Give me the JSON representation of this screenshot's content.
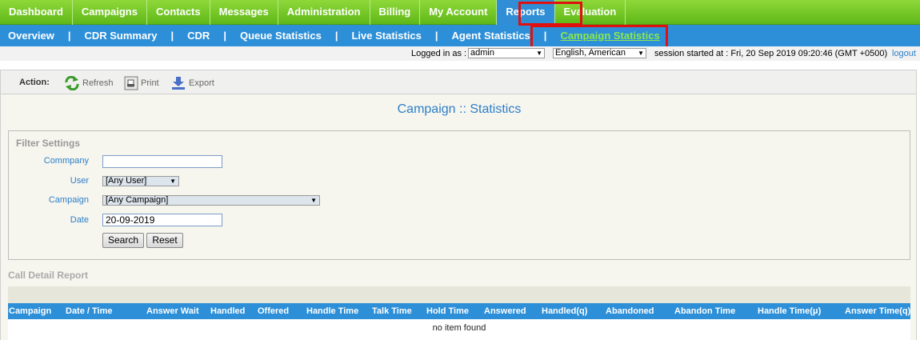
{
  "topnav": {
    "items": [
      "Dashboard",
      "Campaigns",
      "Contacts",
      "Messages",
      "Administration",
      "Billing",
      "My Account",
      "Reports",
      "Evaluation"
    ],
    "active": "Reports"
  },
  "subnav": {
    "items": [
      "Overview",
      "CDR Summary",
      "CDR",
      "Queue Statistics",
      "Live Statistics",
      "Agent Statistics",
      "Campaign Statistics"
    ],
    "separator": "|",
    "active": "Campaign Statistics"
  },
  "loginbar": {
    "logged_in_label": "Logged in as :",
    "user": "admin",
    "language": "English, American",
    "session_text": "session started at : Fri, 20 Sep 2019 09:20:46 (GMT +0500)",
    "logout": "logout"
  },
  "actions": {
    "label": "Action:",
    "refresh": "Refresh",
    "print": "Print",
    "export": "Export"
  },
  "page_title": "Campaign :: Statistics",
  "filter": {
    "legend": "Filter Settings",
    "company_label": "Commpany",
    "company_value": "",
    "user_label": "User",
    "user_value": "[Any User]",
    "campaign_label": "Campaign",
    "campaign_value": "[Any Campaign]",
    "date_label": "Date",
    "date_value": "20-09-2019",
    "search_button": "Search",
    "reset_button": "Reset"
  },
  "report": {
    "title": "Call Detail Report",
    "columns": [
      "Campaign",
      "Date / Time",
      "Answer Wait",
      "Handled",
      "Offered",
      "Handle Time",
      "Talk Time",
      "Hold Time",
      "Answered",
      "Handled(q)",
      "Abandoned",
      "Abandon Time",
      "Handle Time(μ)",
      "Answer Time(q)"
    ],
    "empty_text": "no item found"
  },
  "colors": {
    "nav_green": "#6cc423",
    "nav_blue": "#2c8fd8",
    "highlight_red": "#e01010"
  }
}
